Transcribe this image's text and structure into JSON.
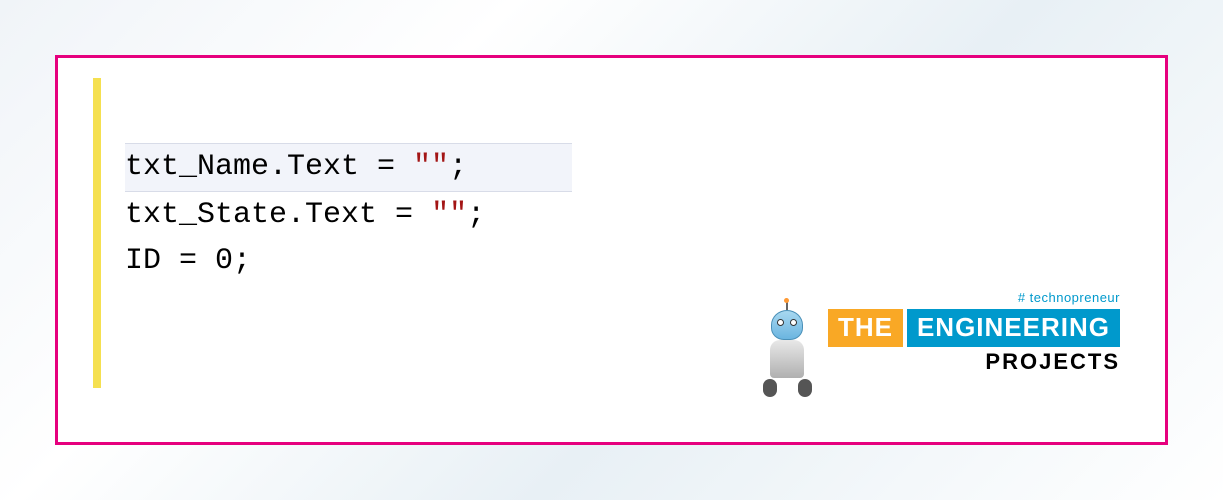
{
  "code": {
    "line1_prefix": "txt_Name.Text = ",
    "line1_string": "\"\"",
    "line1_suffix": ";",
    "line2_prefix": "txt_State.Text = ",
    "line2_string": "\"\"",
    "line2_suffix": ";",
    "line3_prefix": "ID = ",
    "line3_number": "0",
    "line3_suffix": ";"
  },
  "logo": {
    "tagline": "# technopreneur",
    "word_the": "THE",
    "word_engineering": "ENGINEERING",
    "word_projects": "PROJECTS"
  }
}
